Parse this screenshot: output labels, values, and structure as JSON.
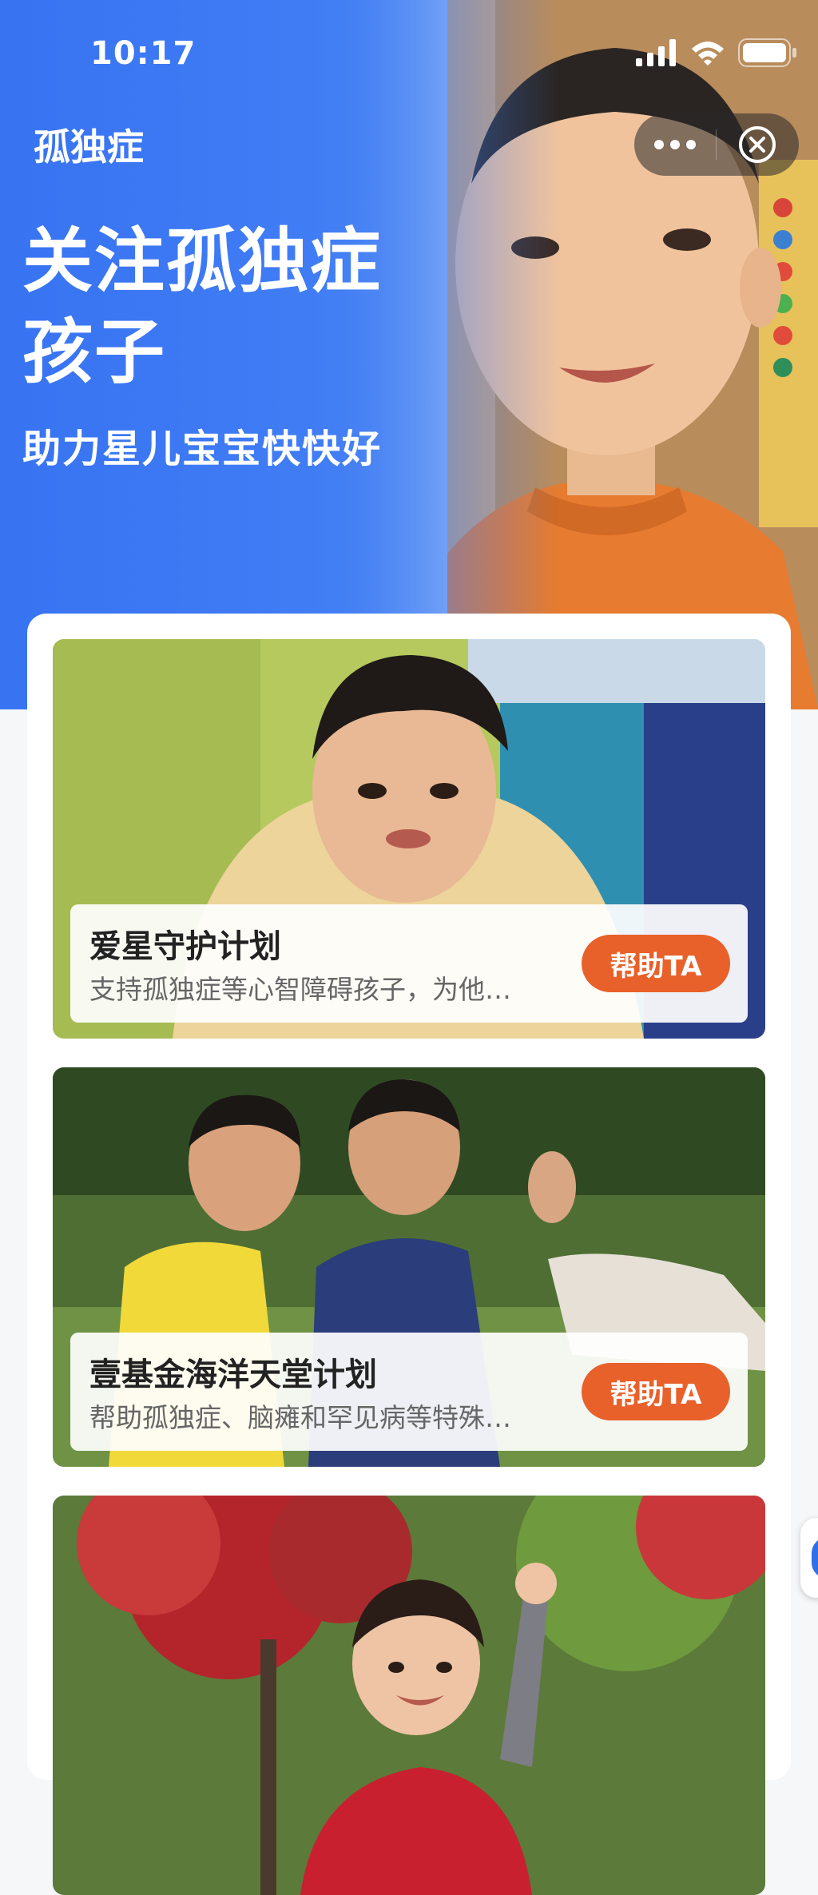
{
  "status_bar": {
    "time": "10:17"
  },
  "nav": {
    "title": "孤独症"
  },
  "hero": {
    "headline": "关注孤独症孩子",
    "subline": "助力星儿宝宝快快好"
  },
  "icons": {
    "more": "more-dots-icon",
    "close": "close-circle-icon",
    "signal": "signal-icon",
    "wifi": "wifi-icon",
    "battery": "battery-icon"
  },
  "colors": {
    "hero_blue": "#3a78f2",
    "button_orange": "#e8612a"
  },
  "cards": [
    {
      "title": "爱星守护计划",
      "desc": "支持孤独症等心智障碍孩子，为他…",
      "button": "帮助TA"
    },
    {
      "title": "壹基金海洋天堂计划",
      "desc": "帮助孤独症、脑瘫和罕见病等特殊…",
      "button": "帮助TA"
    },
    {
      "title": "",
      "desc": "",
      "button": ""
    }
  ]
}
